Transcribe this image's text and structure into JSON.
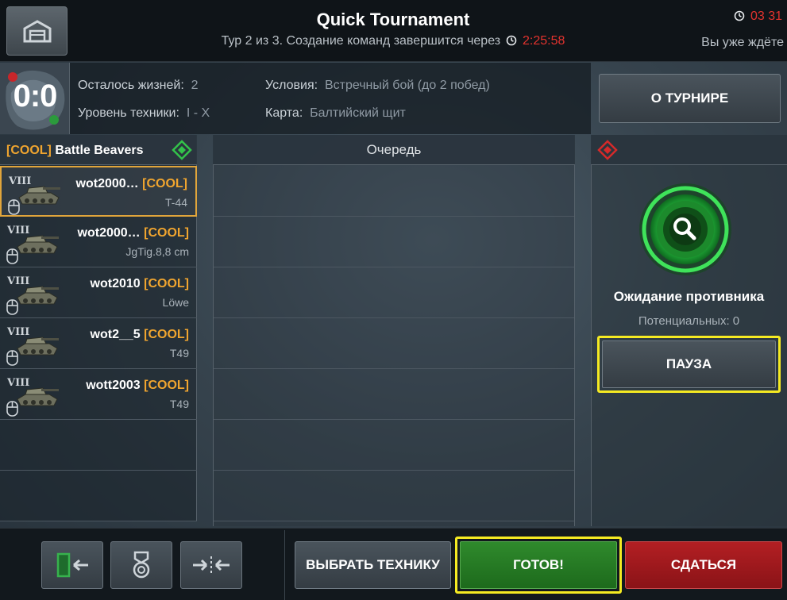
{
  "header": {
    "title": "Quick Tournament",
    "round_text": "Тур 2 из 3. Создание команд завершится через",
    "round_timer": "2:25:58",
    "top_timer": "03 31",
    "waiting_label": "Вы уже ждёте"
  },
  "info": {
    "score": "0:0",
    "lives_label": "Осталось жизней:",
    "lives_value": "2",
    "tier_label": "Уровень техники:",
    "tier_value": "I - X",
    "conditions_label": "Условия:",
    "conditions_value": "Встречный бой (до 2 побед)",
    "map_label": "Карта:",
    "map_value": "Балтийский щит"
  },
  "about_button": "О ТУРНИРЕ",
  "team": {
    "tag": "[COOL]",
    "name": "Battle Beavers",
    "players": [
      {
        "tier": "VIII",
        "name": "wot2000…",
        "tag": "[COOL]",
        "tank": "T-44",
        "selected": true
      },
      {
        "tier": "VIII",
        "name": "wot2000…",
        "tag": "[COOL]",
        "tank": "JgTig.8,8 cm",
        "selected": false
      },
      {
        "tier": "VIII",
        "name": "wot2010",
        "tag": "[COOL]",
        "tank": "Löwe",
        "selected": false
      },
      {
        "tier": "VIII",
        "name": "wot2__5",
        "tag": "[COOL]",
        "tank": "T49",
        "selected": false
      },
      {
        "tier": "VIII",
        "name": "wott2003",
        "tag": "[COOL]",
        "tank": "T49",
        "selected": false
      }
    ]
  },
  "queue": {
    "title": "Очередь"
  },
  "opponent": {
    "status": "Ожидание противника",
    "potential": "Потенциальных: 0",
    "pause_button": "ПАУЗА"
  },
  "bottom": {
    "select_vehicle": "ВЫБРАТЬ ТЕХНИКУ",
    "ready": "ГОТОВ!",
    "surrender": "СДАТЬСЯ"
  },
  "colors": {
    "accent_orange": "#f0a52f",
    "timer_red": "#e2332e",
    "ready_green": "#2f8a2c",
    "surrender_red": "#b31f23",
    "highlight_yellow": "#f5ea22"
  }
}
